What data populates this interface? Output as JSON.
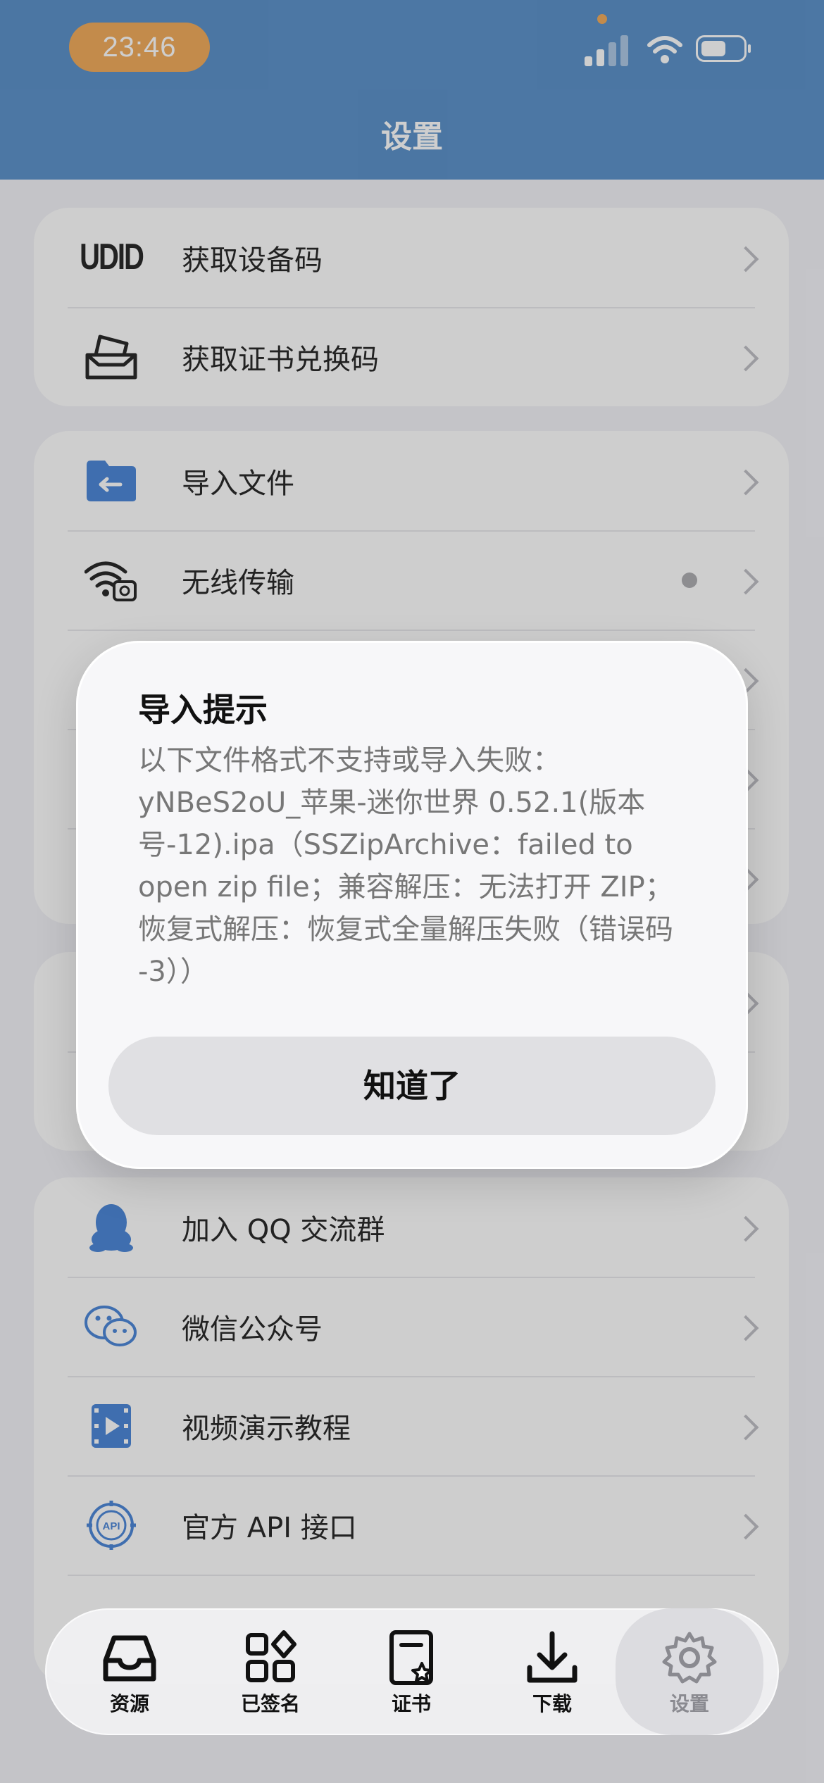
{
  "status": {
    "time": "23:46"
  },
  "header": {
    "title": "设置"
  },
  "group1": [
    {
      "label": "获取设备码",
      "icon": "udid-icon"
    },
    {
      "label": "获取证书兑换码",
      "icon": "ticket-box-icon"
    }
  ],
  "group2": [
    {
      "label": "导入文件",
      "icon": "folder-import-icon"
    },
    {
      "label": "无线传输",
      "icon": "wireless-transfer-icon"
    }
  ],
  "group4": [
    {
      "label": "加入 QQ 交流群",
      "icon": "qq-penguin-icon"
    },
    {
      "label": "微信公众号",
      "icon": "wechat-icon"
    },
    {
      "label": "视频演示教程",
      "icon": "video-icon"
    },
    {
      "label": "官方 API 接口",
      "icon": "api-gear-icon"
    }
  ],
  "modal": {
    "title": "导入提示",
    "body": "以下文件格式不支持或导入失败：\nyNBeS2oU_苹果-迷你世界 0.52.1(版本号-12).ipa（SSZipArchive：failed to open zip file；兼容解压：无法打开 ZIP；恢复式解压：恢复式全量解压失败（错误码 -3））",
    "button": "知道了"
  },
  "tabbar": [
    {
      "label": "资源",
      "icon": "inbox-tray-icon"
    },
    {
      "label": "已签名",
      "icon": "apps-grid-icon"
    },
    {
      "label": "证书",
      "icon": "certificate-icon"
    },
    {
      "label": "下载",
      "icon": "download-icon"
    },
    {
      "label": "设置",
      "icon": "gear-icon"
    }
  ],
  "colors": {
    "header": "#4a86c4",
    "time_pill": "#f0a24a",
    "icon_blue": "#3a7bd5"
  }
}
